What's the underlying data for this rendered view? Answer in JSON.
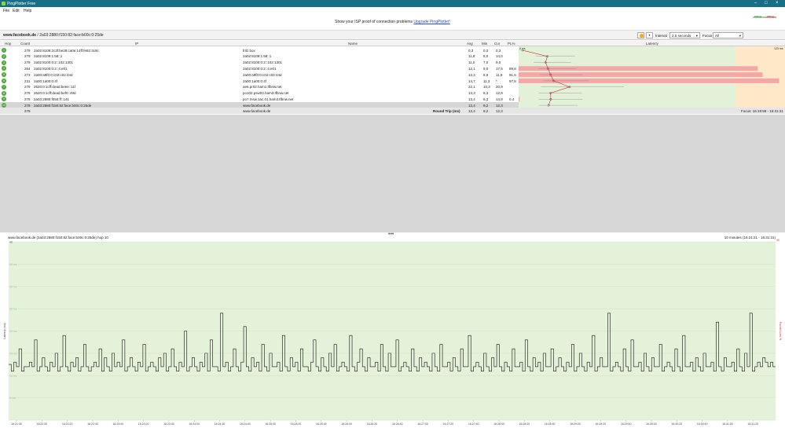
{
  "window": {
    "title": "PingPlotter Free"
  },
  "menu": [
    "File",
    "Edit",
    "Help"
  ],
  "promo": {
    "text": "Show your ISP proof of connection problems",
    "link": "Upgrade PingPlotter!"
  },
  "legend": {
    "low": "100ms",
    "high": "200ms",
    "low_color": "#3aa83a",
    "high_color": "#e33030"
  },
  "target": {
    "name": "www.facebook.de",
    "sep": " / ",
    "ip": "2a03:2880:f150:82:face:b00c:0:25de",
    "interval_label": "Interval",
    "interval_value": "2.5 seconds",
    "focus_label": "Focus",
    "focus_value": "All"
  },
  "columns": {
    "hop": "Hop",
    "count": "Count",
    "ip": "IP",
    "name": "Name",
    "avg": "Avg",
    "min": "Min",
    "cur": "Cur",
    "pl": "PL%",
    "latency": "Latency",
    "lat_min": "0 ms",
    "lat_max": "123 ms"
  },
  "hops": [
    {
      "hop": "1",
      "count": "279",
      "ip": "2a02:8109:2c3f:be28:ca0e:14ff:fe82:3c9c",
      "name": "fritz.box",
      "avg": "0,3",
      "min": "0,2",
      "cur": "0,3",
      "pl": ""
    },
    {
      "hop": "2",
      "count": "279",
      "ip": "2a02:8109:1:58::1",
      "name": "2a02:8109:1:58::1",
      "avg": "11,8",
      "min": "8,0",
      "cur": "14,0",
      "pl": ""
    },
    {
      "hop": "3",
      "count": "279",
      "ip": "2a02:8100:0:2::102:1301",
      "name": "2a02:8100:0:2::102:1301",
      "avg": "11,0",
      "min": "7,0",
      "cur": "9,0",
      "pl": ""
    },
    {
      "hop": "4",
      "count": "264",
      "ip": "2a02:8100:0:2::4:e01",
      "name": "2a02:8100:0:2::4:e01",
      "avg": "12,1",
      "min": "9,0",
      "cur": "17,5",
      "pl": "89,8"
    },
    {
      "hop": "5",
      "count": "273",
      "ip": "2a00:a9f0:0:c02:c02:44d",
      "name": "2a00:a9f0:0:c02:c02:44d",
      "avg": "13,3",
      "min": "9,9",
      "cur": "11,9",
      "pl": "91,6"
    },
    {
      "hop": "6",
      "count": "231",
      "ip": "2a00:1a00:0:4f",
      "name": "2a00:1a00:0:4f",
      "avg": "14,7",
      "min": "11,3",
      "cur": "*",
      "pl": "97,8"
    },
    {
      "hop": "7",
      "count": "279",
      "ip": "2620:0:1cff:dead:beee::11f",
      "name": "ae6.pr02.ham1.tfbnw.net",
      "avg": "22,1",
      "min": "10,3",
      "cur": "20,9",
      "pl": ""
    },
    {
      "hop": "8",
      "count": "278",
      "ip": "2620:0:1cff:dead:bef0::49d",
      "name": "po102.psw03.ham3.tfbnw.net",
      "avg": "13,3",
      "min": "9,3",
      "cur": "12,9",
      "pl": ""
    },
    {
      "hop": "9",
      "count": "278",
      "ip": "2a03:2880:f050:ff::141",
      "name": "po7.msw.1ac.01.ham3.tfbnw.net",
      "avg": "13,4",
      "min": "9,3",
      "cur": "14,8",
      "pl": "0,4"
    },
    {
      "hop": "10",
      "count": "278",
      "ip": "2a03:2880:f150:82:face:b00c:0:25de",
      "name": "www.facebook.de",
      "avg": "12,4",
      "min": "9,2",
      "cur": "12,3",
      "pl": ""
    }
  ],
  "summary": {
    "count": "278",
    "name": "www.facebook.de",
    "label": "Round Trip (ms)",
    "avg": "12,4",
    "min": "9,2",
    "cur": "12,3",
    "focus": "Focus: 16:19:58 - 16:31:31"
  },
  "chart_data": {
    "type": "line",
    "title": "www.facebook.de (2a03:2880:f150:82:face:b00c:0:25de) hop 10",
    "range_label": "10 minutes (16:21:21 - 16:31:31)",
    "ylabel": "Latency (ms)",
    "y2label": "Packet Loss %",
    "ylim": [
      0,
      40
    ],
    "y2_max": "30",
    "yticks": [
      "40",
      "35 ms",
      "30 ms",
      "25 ms",
      "20 ms",
      "15 ms",
      "10 ms",
      "5 ms"
    ],
    "xticks": [
      "16:21:40",
      "16:22:00",
      "16:22:20",
      "16:22:40",
      "16:23:00",
      "16:23:20",
      "16:23:40",
      "16:24:00",
      "16:24:20",
      "16:24:40",
      "16:25:00",
      "16:25:20",
      "16:25:40",
      "16:26:00",
      "16:26:20",
      "16:26:40",
      "16:27:00",
      "16:27:20",
      "16:27:40",
      "16:28:00",
      "16:28:20",
      "16:28:40",
      "16:29:00",
      "16:29:20",
      "16:29:40",
      "16:30:00",
      "16:30:20",
      "16:30:40",
      "16:31:00",
      "16:31:20"
    ],
    "values": [
      12.5,
      11,
      13,
      12,
      16,
      11,
      12,
      12,
      13,
      12,
      18,
      11,
      12,
      14,
      12,
      11,
      13,
      12,
      15,
      11,
      12,
      19,
      12,
      11,
      13,
      12,
      14,
      11,
      12,
      17,
      12,
      11,
      12,
      13,
      12,
      16,
      11,
      14,
      12,
      11,
      15,
      12,
      13,
      12,
      18,
      11,
      12,
      14,
      12,
      11,
      13,
      12,
      17,
      11,
      12,
      13,
      12,
      11,
      14,
      12,
      15,
      11,
      12,
      16,
      12,
      11,
      13,
      12,
      20,
      11,
      12,
      14,
      12,
      11,
      13,
      12,
      15,
      11,
      18,
      12,
      12,
      11,
      24,
      12,
      13,
      11,
      12,
      16,
      12,
      11,
      13,
      21,
      12,
      11,
      14,
      12,
      13,
      11,
      17,
      12,
      11,
      15,
      12,
      12,
      13,
      11,
      19,
      12,
      11,
      14,
      12,
      13,
      11,
      16,
      12,
      12,
      11,
      13,
      18,
      12,
      11,
      14,
      12,
      11,
      15,
      12,
      17,
      11,
      12,
      13,
      12,
      11,
      19,
      12,
      11,
      13,
      16,
      12,
      11,
      14,
      12,
      12,
      13,
      11,
      17,
      12,
      11,
      15,
      12,
      12,
      18,
      11,
      12,
      13,
      12,
      11,
      16,
      12,
      11,
      14,
      12,
      13,
      12,
      11,
      15,
      12,
      11,
      17,
      12,
      12,
      13,
      11,
      14,
      12,
      11,
      16,
      12,
      12,
      19,
      11,
      12,
      13,
      12,
      11,
      15,
      12,
      11,
      14,
      12,
      17,
      12,
      11,
      13,
      12,
      11,
      16,
      12,
      12,
      13,
      11,
      18,
      12,
      11,
      14,
      12,
      13,
      11,
      15,
      12,
      12,
      16,
      11,
      12,
      14,
      12,
      11,
      13,
      12,
      17,
      11,
      12,
      15,
      12,
      11,
      13,
      12,
      19,
      11,
      12,
      14,
      12,
      12,
      24,
      11,
      12,
      13,
      12,
      11,
      16,
      12,
      11,
      18,
      12,
      12,
      13,
      11,
      15,
      12,
      11,
      14,
      12,
      12,
      17,
      11,
      12,
      13,
      12,
      11,
      16,
      12,
      11,
      19,
      12,
      12,
      13,
      11,
      14,
      12,
      11,
      15,
      12,
      12,
      13,
      11,
      22,
      12,
      11,
      14,
      12,
      12,
      13,
      11,
      16,
      12,
      11,
      15,
      12,
      24,
      11,
      12,
      13,
      12,
      14,
      13,
      12,
      13,
      12
    ]
  }
}
